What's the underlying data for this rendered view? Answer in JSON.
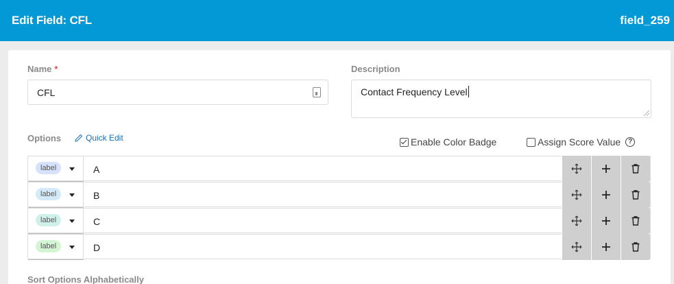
{
  "header": {
    "title": "Edit Field: CFL",
    "field_id": "field_259"
  },
  "name": {
    "label": "Name",
    "required_mark": "*",
    "value": "CFL"
  },
  "description": {
    "label": "Description",
    "value": "Contact Frequency Level"
  },
  "options": {
    "label": "Options",
    "quick_edit": "Quick Edit",
    "enable_color_badge": {
      "label": "Enable Color Badge",
      "checked": true
    },
    "assign_score_value": {
      "label": "Assign Score Value",
      "checked": false
    },
    "items": [
      {
        "badge": "label",
        "badge_color": "#d6e2fb",
        "value": "A"
      },
      {
        "badge": "label",
        "badge_color": "#d2eaf9",
        "value": "B"
      },
      {
        "badge": "label",
        "badge_color": "#d0f1ea",
        "value": "C"
      },
      {
        "badge": "label",
        "badge_color": "#d3f5d3",
        "value": "D"
      }
    ]
  },
  "sort": {
    "label": "Sort Options Alphabetically"
  }
}
